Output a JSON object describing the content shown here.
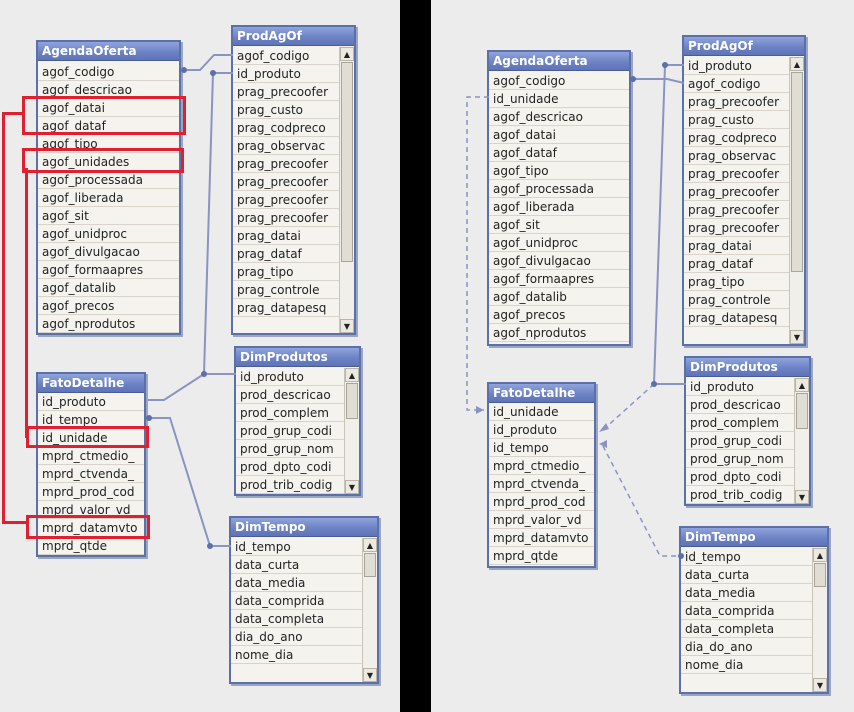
{
  "left": {
    "agenda": {
      "title": "AgendaOferta",
      "rows": [
        "agof_codigo",
        "agof_descricao",
        "agof_datai",
        "agof_dataf",
        "agof_tipo",
        "agof_unidades",
        "agof_processada",
        "agof_liberada",
        "agof_sit",
        "agof_unidproc",
        "agof_divulgacao",
        "agof_formaapres",
        "agof_datalib",
        "agof_precos",
        "agof_nprodutos"
      ]
    },
    "prodagof": {
      "title": "ProdAgOf",
      "rows": [
        "agof_codigo",
        "id_produto",
        "prag_precoofer",
        "prag_custo",
        "prag_codpreco",
        "prag_observac",
        "prag_precoofer",
        "prag_precoofer",
        "prag_precoofer",
        "prag_precoofer",
        "prag_datai",
        "prag_dataf",
        "prag_tipo",
        "prag_controle",
        "prag_datapesq"
      ]
    },
    "fato": {
      "title": "FatoDetalhe",
      "rows": [
        "id_produto",
        "id_tempo",
        "id_unidade",
        "mprd_ctmedio_",
        "mprd_ctvenda_",
        "mprd_prod_cod",
        "mprd_valor_vd",
        "mprd_datamvto",
        "mprd_qtde"
      ]
    },
    "dimprod": {
      "title": "DimProdutos",
      "rows": [
        "id_produto",
        "prod_descricao",
        "prod_complem",
        "prod_grup_codi",
        "prod_grup_nom",
        "prod_dpto_codi",
        "prod_trib_codig"
      ]
    },
    "dimtempo": {
      "title": "DimTempo",
      "rows": [
        "id_tempo",
        "data_curta",
        "data_media",
        "data_comprida",
        "data_completa",
        "dia_do_ano",
        "nome_dia"
      ]
    }
  },
  "right": {
    "agenda": {
      "title": "AgendaOferta",
      "rows": [
        "agof_codigo",
        "id_unidade",
        "agof_descricao",
        "agof_datai",
        "agof_dataf",
        "agof_tipo",
        "agof_processada",
        "agof_liberada",
        "agof_sit",
        "agof_unidproc",
        "agof_divulgacao",
        "agof_formaapres",
        "agof_datalib",
        "agof_precos",
        "agof_nprodutos"
      ]
    },
    "prodagof": {
      "title": "ProdAgOf",
      "rows": [
        "id_produto",
        "agof_codigo",
        "prag_precoofer",
        "prag_custo",
        "prag_codpreco",
        "prag_observac",
        "prag_precoofer",
        "prag_precoofer",
        "prag_precoofer",
        "prag_precoofer",
        "prag_datai",
        "prag_dataf",
        "prag_tipo",
        "prag_controle",
        "prag_datapesq"
      ]
    },
    "fato": {
      "title": "FatoDetalhe",
      "rows": [
        "id_unidade",
        "id_produto",
        "id_tempo",
        "mprd_ctmedio_",
        "mprd_ctvenda_",
        "mprd_prod_cod",
        "mprd_valor_vd",
        "mprd_datamvto",
        "mprd_qtde"
      ]
    },
    "dimprod": {
      "title": "DimProdutos",
      "rows": [
        "id_produto",
        "prod_descricao",
        "prod_complem",
        "prod_grup_codi",
        "prod_grup_nom",
        "prod_dpto_codi",
        "prod_trib_codig"
      ]
    },
    "dimtempo": {
      "title": "DimTempo",
      "rows": [
        "id_tempo",
        "data_curta",
        "data_media",
        "data_comprida",
        "data_completa",
        "dia_do_ano",
        "nome_dia"
      ]
    }
  },
  "icons": {
    "scroll_up": "▲",
    "scroll_down": "▼"
  },
  "colors": {
    "header": "#6d83c4",
    "link": "#8a94c2",
    "highlight": "#e02030"
  }
}
